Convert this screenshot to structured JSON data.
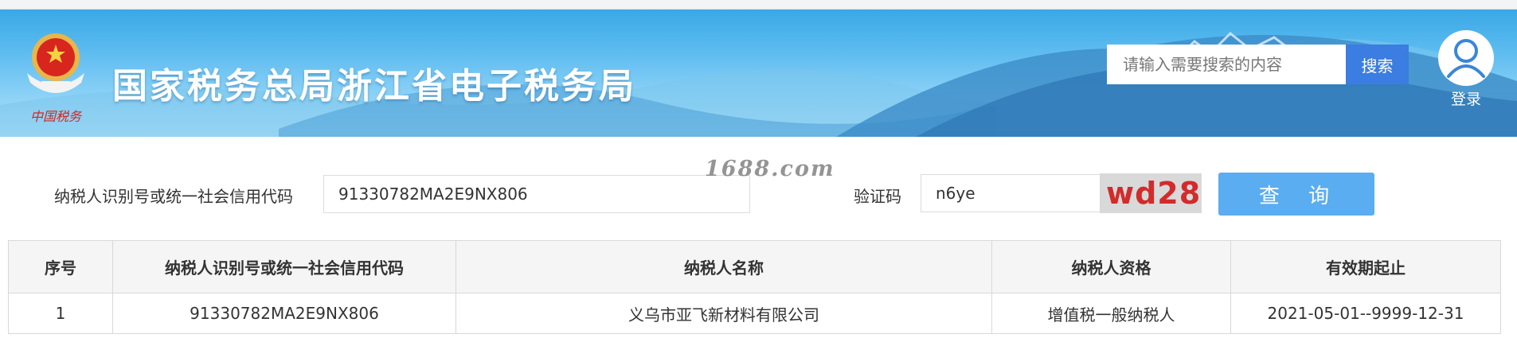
{
  "header": {
    "site_title": "国家税务总局浙江省电子税务局",
    "emblem_text": "中国税务",
    "search": {
      "placeholder": "请输入需要搜索的内容",
      "value": "",
      "button_label": "搜索"
    },
    "login_label": "登录"
  },
  "form": {
    "taxpayer_id_label": "纳税人识别号或统一社会信用代码",
    "taxpayer_id_value": "91330782MA2E9NX806",
    "captcha_label": "验证码",
    "captcha_value": "n6ye",
    "captcha_image_text": "wd28",
    "query_button_label": "查 询"
  },
  "watermark": "1688.com",
  "table": {
    "columns": [
      "序号",
      "纳税人识别号或统一社会信用代码",
      "纳税人名称",
      "纳税人资格",
      "有效期起止"
    ],
    "rows": [
      [
        "1",
        "91330782MA2E9NX806",
        "义乌市亚飞新材料有限公司",
        "增值税一般纳税人",
        "2021-05-01--9999-12-31"
      ]
    ]
  }
}
